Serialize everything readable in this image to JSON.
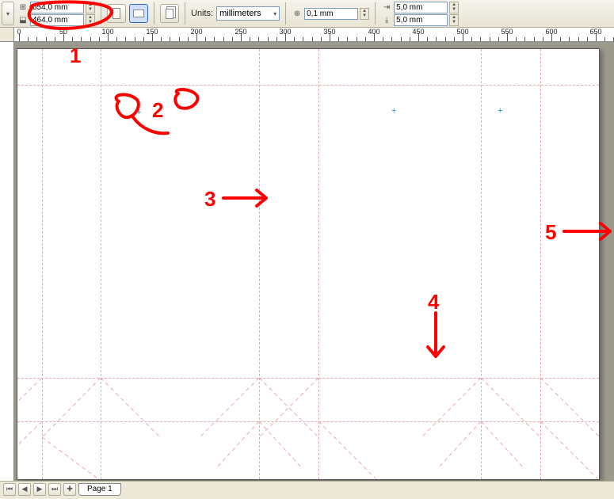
{
  "toolbar": {
    "width_value": "654,0 mm",
    "height_value": "464,0 mm",
    "units_label": "Units:",
    "units_value": "millimeters",
    "nudge_value": "0,1 mm",
    "dupx_value": "5,0 mm",
    "dupy_value": "5,0 mm"
  },
  "ruler": {
    "ticks": [
      0,
      50,
      100,
      150,
      200,
      250,
      300,
      350,
      400,
      450,
      500,
      550,
      600,
      650
    ]
  },
  "annotations": {
    "n1": "1",
    "n2": "2",
    "n3": "3",
    "n4": "4",
    "n5": "5"
  },
  "status": {
    "page_tab": "Page 1"
  }
}
